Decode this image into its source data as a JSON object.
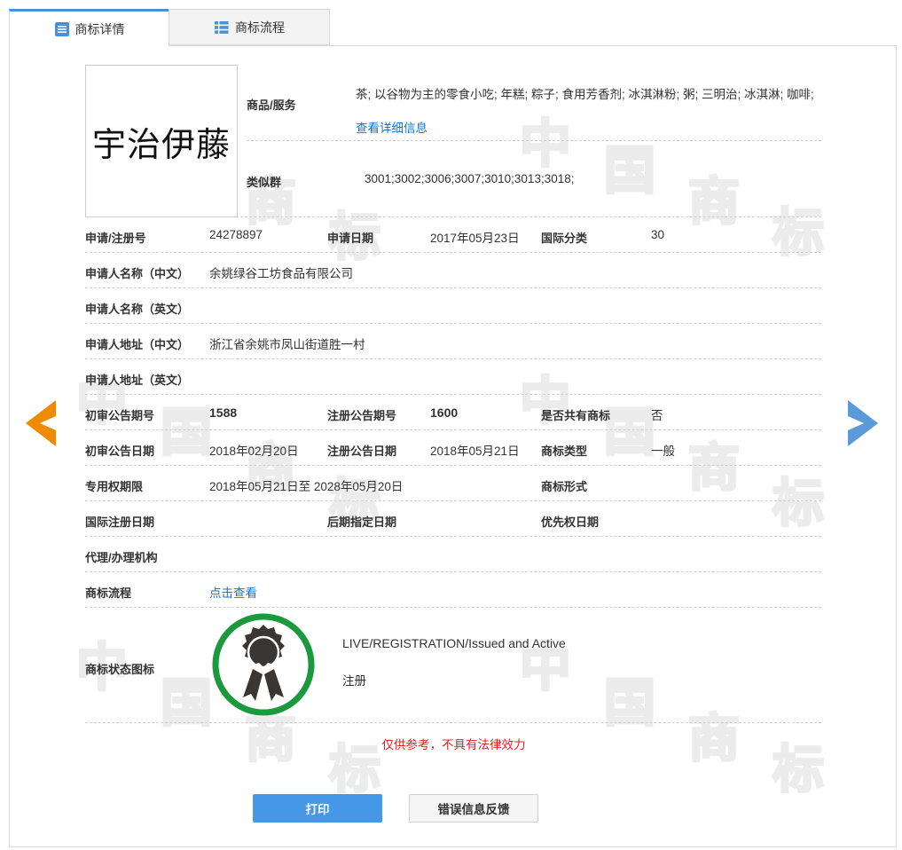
{
  "tabs": [
    {
      "label": "商标详情",
      "active": true
    },
    {
      "label": "商标流程",
      "active": false
    }
  ],
  "logo": {
    "text": "宇治伊藤"
  },
  "goods": {
    "label": "商品/服务",
    "value": "茶; 以谷物为主的零食小吃; 年糕; 粽子; 食用芳香剂; 冰淇淋粉; 粥; 三明治; 冰淇淋; 咖啡;",
    "detail_link": "查看详细信息"
  },
  "similar_group": {
    "label": "类似群",
    "value": "3001;3002;3006;3007;3010;3013;3018;"
  },
  "fields": {
    "reg_no": {
      "label": "申请/注册号",
      "value": "24278897"
    },
    "apply_date": {
      "label": "申请日期",
      "value": "2017年05月23日"
    },
    "intl_class": {
      "label": "国际分类",
      "value": "30"
    },
    "applicant_cn": {
      "label": "申请人名称（中文）",
      "value": "余姚绿谷工坊食品有限公司"
    },
    "applicant_en": {
      "label": "申请人名称（英文）",
      "value": ""
    },
    "address_cn": {
      "label": "申请人地址（中文）",
      "value": "浙江省余姚市凤山街道胜一村"
    },
    "address_en": {
      "label": "申请人地址（英文）",
      "value": ""
    },
    "prelim_pub_no": {
      "label": "初审公告期号",
      "value": "1588"
    },
    "reg_pub_no": {
      "label": "注册公告期号",
      "value": "1600"
    },
    "shared": {
      "label": "是否共有商标",
      "value": "否"
    },
    "prelim_pub_date": {
      "label": "初审公告日期",
      "value": "2018年02月20日"
    },
    "reg_pub_date": {
      "label": "注册公告日期",
      "value": "2018年05月21日"
    },
    "tm_type": {
      "label": "商标类型",
      "value": "一般"
    },
    "exclusive_period": {
      "label": "专用权期限",
      "value": "2018年05月21日至 2028年05月20日"
    },
    "tm_form": {
      "label": "商标形式",
      "value": ""
    },
    "intl_reg_date": {
      "label": "国际注册日期",
      "value": ""
    },
    "later_designation": {
      "label": "后期指定日期",
      "value": ""
    },
    "priority_date": {
      "label": "优先权日期",
      "value": ""
    },
    "agency": {
      "label": "代理/办理机构",
      "value": ""
    },
    "process": {
      "label": "商标流程",
      "link": "点击查看"
    },
    "status_icon": {
      "label": "商标状态图标"
    }
  },
  "status": {
    "en": "LIVE/REGISTRATION/Issued and Active",
    "cn": "注册",
    "ring_color": "#1a9a3c",
    "icon": "award-ribbon-icon"
  },
  "watermark": {
    "chars": [
      "中",
      "国",
      "商",
      "标"
    ]
  },
  "note": "仅供参考，不具有法律效力",
  "buttons": {
    "print": "打印",
    "feedback": "错误信息反馈"
  },
  "colors": {
    "accent": "#4597e8",
    "link": "#1a73c8",
    "prev_arrow": "#f08a00",
    "next_arrow": "#5a9ad8",
    "note": "#e02020"
  }
}
